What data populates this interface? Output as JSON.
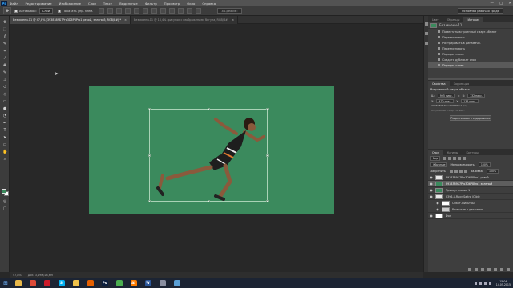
{
  "app": {
    "logo": "Ps",
    "menu": [
      "Файл",
      "Редактирование",
      "Изображение",
      "Слои",
      "Текст",
      "Выделение",
      "Фильтр",
      "Просмотр",
      "Окно",
      "Справка"
    ],
    "window_controls": [
      "—",
      "□",
      "✕"
    ]
  },
  "options_bar": {
    "autoselect_label": "Автовыбор:",
    "autoselect_value": "Слой",
    "show_controls_label": "Показать упр. элем.",
    "mode_3d_label": "3D-режим:",
    "workspace_value": "Основная рабочая среда"
  },
  "tabs": [
    {
      "title": "Без имени-11 @ 47,8% (3938389Б7Pro3D6Р8Pro1 ревой, зеленый, RGB/8#) *",
      "active": true
    },
    {
      "title": "Без имени-11 @ 16,4% (рисунок с изображением бегуна, RGB/8#)",
      "active": false
    }
  ],
  "statusbar": {
    "zoom": "47,8%",
    "doc": "Док: 3,49М/28,6М"
  },
  "history_panel": {
    "tabs": [
      "Цвет",
      "Образцы",
      "История"
    ],
    "active_tab": "История",
    "snapshot_label": "Без имени-11",
    "items": [
      "Поместить встроенный смарт-объект",
      "Переименовать",
      "Растрировать в динамичн.",
      "Переименовать",
      "Порядок слоев",
      "Создать дубликат слоя",
      "Порядок слоев"
    ],
    "selected_index": 6
  },
  "properties_panel": {
    "tabs": [
      "Свойства",
      "Коррекция"
    ],
    "title": "Встроенный смарт-объект",
    "width_label": "Ш:",
    "width_value": "995 пикс.",
    "height_label": "В:",
    "height_value": "732 пикс.",
    "x_label": "X:",
    "x_value": "470 пикс.",
    "y_label": "Y:",
    "y_value": "136 пикс.",
    "file_path": "3938389Б7Pro3D6Р8Pro1.png",
    "file_sub": "Встроенный смарт-объект",
    "edit_button": "Редактировать содержимое"
  },
  "layers_panel": {
    "tabs": [
      "Слои",
      "Каналы",
      "Контуры"
    ],
    "kind_label": "Вид",
    "blend_mode": "Обычные",
    "opacity_label": "Непрозрачность:",
    "opacity_value": "100%",
    "lock_label": "Закрепить:",
    "fill_label": "Заливка:",
    "fill_value": "100%",
    "layers": [
      {
        "name": "3938389Б7Pro3D6Р8Pro1 ревой",
        "thumb": "#e8e8e8",
        "selected": false,
        "sub": false
      },
      {
        "name": "3938389Б7Pro3D6Р8Pro1 зеленый",
        "thumb": "#3b8a5d",
        "selected": true,
        "sub": false
      },
      {
        "name": "Прямоугольник 1",
        "thumb": "#3b8a5d",
        "selected": false,
        "sub": false
      },
      {
        "name": "5396-8-Ruxy-Saltro (Olide",
        "thumb": "#e8e8e8",
        "selected": false,
        "sub": false
      },
      {
        "name": "Смарт-фильтры",
        "thumb": "#ffffff",
        "selected": false,
        "sub": true
      },
      {
        "name": "Размытие в движении",
        "thumb": "#cccccc",
        "selected": false,
        "sub": true
      },
      {
        "name": "Фон",
        "thumb": "#ffffff",
        "selected": false,
        "sub": false
      }
    ]
  },
  "taskbar": {
    "apps": [
      {
        "icon": "explorer-icon",
        "label": "",
        "color": "#e8b84a"
      },
      {
        "icon": "chrome-icon",
        "label": "",
        "color": "#dd4b39"
      },
      {
        "icon": "opera-icon",
        "label": "",
        "color": "#cc1b2a"
      },
      {
        "icon": "skype-icon",
        "label": "S",
        "color": "#00aff0"
      },
      {
        "icon": "folder-icon",
        "label": "",
        "color": "#f0c24a"
      },
      {
        "icon": "firefox-icon",
        "label": "",
        "color": "#e66000"
      },
      {
        "icon": "photoshop-icon",
        "label": "Ps",
        "color": "#0c1f3e"
      },
      {
        "icon": "media-icon",
        "label": "",
        "color": "#4caf50"
      },
      {
        "icon": "illustrator-icon",
        "label": "Ai",
        "color": "#ff7c00"
      },
      {
        "icon": "word-icon",
        "label": "W",
        "color": "#2b579a"
      },
      {
        "icon": "settings-icon",
        "label": "",
        "color": "#8a8fa0"
      },
      {
        "icon": "media-player-icon",
        "label": "",
        "color": "#5a9fd4"
      }
    ],
    "time": "15:04",
    "date": "14.05.2015"
  }
}
